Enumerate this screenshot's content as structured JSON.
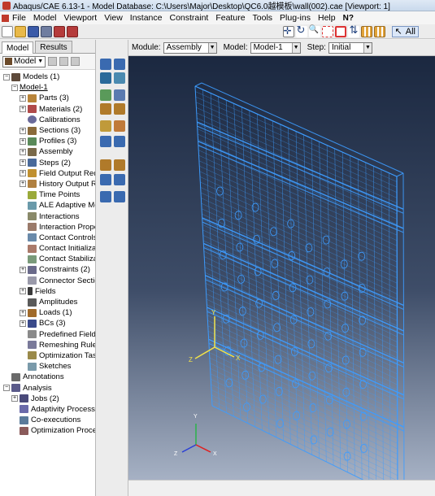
{
  "window": {
    "title": "Abaqus/CAE 6.13-1 - Model Database: C:\\Users\\Major\\Desktop\\QC6.0越模板\\wall(002).cae [Viewport: 1]"
  },
  "menu": [
    "File",
    "Model",
    "Viewport",
    "View",
    "Instance",
    "Constraint",
    "Feature",
    "Tools",
    "Plug-ins",
    "Help",
    "N?"
  ],
  "toolbar": {
    "selection_filter": "All"
  },
  "tabs": [
    "Model",
    "Results"
  ],
  "tree_toolbar": {
    "model_select": "Model"
  },
  "tree": [
    {
      "label": "Models (1)",
      "expander": "−",
      "icon": "models-icon",
      "indent": 0
    },
    {
      "label": "Model-1",
      "expander": "−",
      "icon": "",
      "indent": 1,
      "underline": true
    },
    {
      "label": "Parts (3)",
      "expander": "+",
      "icon": "parts-icon",
      "indent": 2
    },
    {
      "label": "Materials (2)",
      "expander": "+",
      "icon": "materials-icon",
      "indent": 2
    },
    {
      "label": "Calibrations",
      "expander": "",
      "icon": "calibrations-icon",
      "indent": 2
    },
    {
      "label": "Sections (3)",
      "expander": "+",
      "icon": "sections-icon",
      "indent": 2
    },
    {
      "label": "Profiles (3)",
      "expander": "+",
      "icon": "profiles-icon",
      "indent": 2
    },
    {
      "label": "Assembly",
      "expander": "+",
      "icon": "assembly-icon",
      "indent": 2
    },
    {
      "label": "Steps (2)",
      "expander": "+",
      "icon": "steps-icon",
      "indent": 2
    },
    {
      "label": "Field Output Requ",
      "expander": "+",
      "icon": "field-output-icon",
      "indent": 2
    },
    {
      "label": "History Output Re",
      "expander": "+",
      "icon": "history-output-icon",
      "indent": 2
    },
    {
      "label": "Time Points",
      "expander": "",
      "icon": "time-points-icon",
      "indent": 2
    },
    {
      "label": "ALE Adaptive Mes",
      "expander": "",
      "icon": "ale-icon",
      "indent": 2
    },
    {
      "label": "Interactions",
      "expander": "",
      "icon": "interactions-icon",
      "indent": 2
    },
    {
      "label": "Interaction Proper",
      "expander": "",
      "icon": "interaction-properties-icon",
      "indent": 2
    },
    {
      "label": "Contact Controls",
      "expander": "",
      "icon": "contact-controls-icon",
      "indent": 2
    },
    {
      "label": "Contact Initializati",
      "expander": "",
      "icon": "contact-init-icon",
      "indent": 2
    },
    {
      "label": "Contact Stabilizati",
      "expander": "",
      "icon": "contact-stab-icon",
      "indent": 2
    },
    {
      "label": "Constraints (2)",
      "expander": "+",
      "icon": "constraints-icon",
      "indent": 2
    },
    {
      "label": "Connector Section",
      "expander": "",
      "icon": "connector-icon",
      "indent": 2
    },
    {
      "label": "Fields",
      "expander": "+",
      "icon": "fields-icon",
      "indent": 2
    },
    {
      "label": "Amplitudes",
      "expander": "",
      "icon": "amplitudes-icon",
      "indent": 2
    },
    {
      "label": "Loads (1)",
      "expander": "+",
      "icon": "loads-icon",
      "indent": 2
    },
    {
      "label": "BCs (3)",
      "expander": "+",
      "icon": "bcs-icon",
      "indent": 2
    },
    {
      "label": "Predefined Fields",
      "expander": "",
      "icon": "predefined-fields-icon",
      "indent": 2
    },
    {
      "label": "Remeshing Rules",
      "expander": "",
      "icon": "remeshing-icon",
      "indent": 2
    },
    {
      "label": "Optimization Task",
      "expander": "",
      "icon": "optimization-task-icon",
      "indent": 2
    },
    {
      "label": "Sketches",
      "expander": "",
      "icon": "sketches-icon",
      "indent": 2
    },
    {
      "label": "Annotations",
      "expander": "",
      "icon": "annotations-icon",
      "indent": 0
    },
    {
      "label": "Analysis",
      "expander": "−",
      "icon": "analysis-icon",
      "indent": 0
    },
    {
      "label": "Jobs (2)",
      "expander": "+",
      "icon": "jobs-icon",
      "indent": 1
    },
    {
      "label": "Adaptivity Processes",
      "expander": "",
      "icon": "adaptivity-icon",
      "indent": 1
    },
    {
      "label": "Co-executions",
      "expander": "",
      "icon": "coexec-icon",
      "indent": 1
    },
    {
      "label": "Optimization Process",
      "expander": "",
      "icon": "optimization-process-icon",
      "indent": 1
    }
  ],
  "context": {
    "module_label": "Module:",
    "module_value": "Assembly",
    "model_label": "Model:",
    "model_value": "Model-1",
    "step_label": "Step:",
    "step_value": "Initial"
  },
  "viewport": {
    "mesh_color": "#3d9cff",
    "triad_labels": {
      "y": "Y",
      "z": "Z",
      "x": "X"
    },
    "origin_labels": {
      "y": "Y",
      "z": "Z",
      "x": "X"
    }
  }
}
